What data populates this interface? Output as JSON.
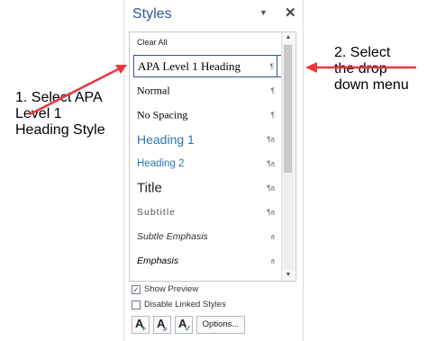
{
  "pane": {
    "title": "Styles",
    "title_dropdown_icon": "caret-down",
    "close_glyph": "✕",
    "clear_all": "Clear All"
  },
  "styles": [
    {
      "label": "APA Level 1 Heading",
      "marker": "¶",
      "selected": true
    },
    {
      "label": "Normal",
      "marker": "¶"
    },
    {
      "label": "No Spacing",
      "marker": "¶"
    },
    {
      "label": "Heading 1",
      "marker": "¶a"
    },
    {
      "label": "Heading 2",
      "marker": "¶a"
    },
    {
      "label": "Title",
      "marker": "¶a"
    },
    {
      "label": "Subtitle",
      "marker": "¶a"
    },
    {
      "label": "Subtle Emphasis",
      "marker": "a"
    },
    {
      "label": "Emphasis",
      "marker": "a"
    }
  ],
  "options": {
    "show_preview": "Show Preview",
    "show_preview_checked": true,
    "disable_linked": "Disable Linked Styles",
    "disable_linked_checked": false,
    "options_button": "Options..."
  },
  "annotations": {
    "left": "1. Select APA\nLevel 1\nHeading Style",
    "right": "2. Select\nthe drop\ndown menu"
  },
  "colors": {
    "accent": "#2b579a",
    "heading": "#2e74b5",
    "arrow": "#e8383d"
  }
}
